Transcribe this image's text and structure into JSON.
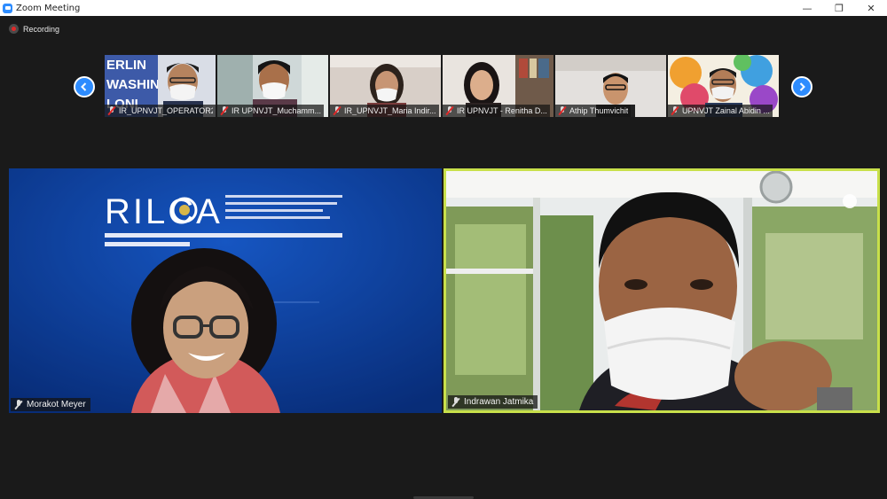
{
  "window": {
    "title": "Zoom Meeting",
    "controls": {
      "minimize": "—",
      "restore": "❐",
      "close": "✕"
    }
  },
  "recording": {
    "label": "Recording"
  },
  "thumbnails": {
    "prev_icon": "chevron-left-icon",
    "next_icon": "chevron-right-icon",
    "items": [
      {
        "name": "IR_UPNVJT_OPERATOR2",
        "muted": true
      },
      {
        "name": "IR UPNVJT_Muchamm...",
        "muted": true
      },
      {
        "name": "IR_UPNVJT_Maria Indir...",
        "muted": true
      },
      {
        "name": "IR UPNVJT - Renitha D...",
        "muted": true
      },
      {
        "name": "Athip Thumvichit",
        "muted": true
      },
      {
        "name": "UPNVJT Zainal Abidin ...",
        "muted": true
      }
    ]
  },
  "gallery": {
    "left": {
      "name": "Morakot Meyer"
    },
    "right": {
      "name": "Indrawan Jatmika",
      "active_speaker": true
    }
  },
  "colors": {
    "accent": "#2d8cff",
    "active_speaker_border": "#c8e04a",
    "background": "#1a1a1a",
    "recording_dot": "#e02828"
  }
}
